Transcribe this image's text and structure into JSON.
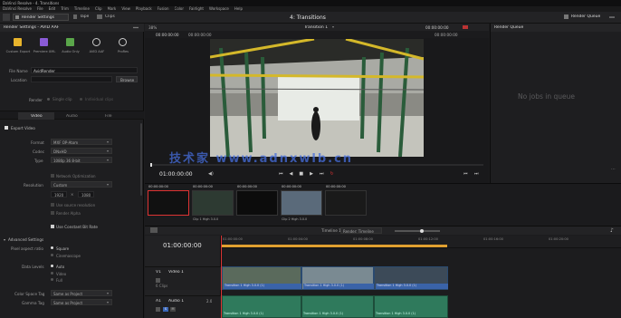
{
  "titlebar": {
    "title": "DaVinci Resolve - 4. Transitions",
    "menu": [
      "DaVinci Resolve",
      "File",
      "Edit",
      "Trim",
      "Timeline",
      "Clip",
      "Mark",
      "View",
      "Playback",
      "Fusion",
      "Color",
      "Fairlight",
      "Workspace",
      "Help"
    ]
  },
  "toolbar": {
    "render_settings": "Render Settings",
    "tape": "Tape",
    "clips": "Clips",
    "project_title": "4: Transitions",
    "render_queue": "Render Queue"
  },
  "render_settings": {
    "header": "Render Settings - AVID AAF",
    "presets": [
      {
        "label": "Custom Export",
        "icon": "clapper-icon",
        "color": "#e8b42c"
      },
      {
        "label": "Premiere XML",
        "icon": "premiere-icon",
        "color": "#8a5bd6"
      },
      {
        "label": "Audio Only",
        "icon": "audio-icon",
        "color": "#5aa64a"
      },
      {
        "label": "AVID AAF",
        "icon": "avid-icon",
        "color": "#cccccc"
      },
      {
        "label": "ProRes",
        "icon": "prores-icon",
        "color": "#cccccc"
      }
    ],
    "filename_label": "File Name",
    "filename_value": "AvidRender",
    "location_label": "Location",
    "browse_label": "Browse",
    "render_label": "Render",
    "single_clip": "Single clip",
    "individual_clips": "Individual clips",
    "tabs": [
      "Video",
      "Audio",
      "File"
    ],
    "export_video": "Export Video",
    "format_label": "Format",
    "format_value": "MXF OP-Atom",
    "codec_label": "Codec",
    "codec_value": "DNxHD",
    "type_label": "Type",
    "type_value": "1080p 36 8-bit",
    "network_opt": "Network Optimization",
    "resolution_label": "Resolution",
    "resolution_value": "Custom",
    "width": "1920",
    "height": "1080",
    "source_res": "Use source resolution",
    "render_alpha": "Render Alpha",
    "use_constant": "Use Constant Bit Rate",
    "advanced": "Advanced Settings",
    "pixel_aspect_label": "Pixel aspect ratio",
    "pixel_opts": [
      "Square",
      "Cinemascope"
    ],
    "data_levels_label": "Data Levels",
    "data_opts": [
      "Auto",
      "Video",
      "Full"
    ],
    "color_space_label": "Color Space Tag",
    "color_space_value": "Same as Project",
    "gamma_label": "Gamma Tag",
    "gamma_value": "Same as Project"
  },
  "viewer": {
    "zoom": "38%",
    "timecode_left": "00:00:00:00",
    "source_tc": "00:00:00:00",
    "clip_name": "Transition 1",
    "tc_right": "00:00:00:00",
    "timecode": "01:00:00:00"
  },
  "clips": {
    "items": [
      {
        "tc": "00:00:00:00",
        "label": "",
        "selected": true
      },
      {
        "tc": "00:00:00:00",
        "label": "Clip 1 High 3.0.0"
      },
      {
        "tc": "00:00:00:00",
        "label": ""
      },
      {
        "tc": "00:00:00:00",
        "label": "Clip 2 High 3.0.0"
      },
      {
        "tc": "00:00:00:00",
        "label": ""
      }
    ]
  },
  "timeline": {
    "timecode": "01:00:00:00",
    "marker_label": "Timeline 1",
    "ruler_marks": [
      "01:00:00:00",
      "01:00:04:00",
      "01:00:08:00",
      "01:00:12:00",
      "01:00:16:00",
      "01:00:20:00"
    ],
    "v1": "V1",
    "v1_name": "Video 1",
    "v1_count": "6 Clips",
    "a1": "A1",
    "a1_name": "Audio 1",
    "a1_level": "2.0",
    "video_clips": [
      "Transition 1 High 3.0.0 (1)",
      "Transition 1 High 3.0.0 (1)",
      "Transition 1 High 3.0.0 (1)"
    ],
    "audio_clips": [
      "Transition 1 High 3.0.0 (1)",
      "Transition 1 High 3.0.0 (1)",
      "Transition 1 High 3.0.0 (1)"
    ],
    "render_range": "Render: Timeline"
  },
  "queue": {
    "title": "Render Queue",
    "empty_text": "No jobs in queue"
  },
  "watermark": "技术家 www.adnxwlb.cn"
}
